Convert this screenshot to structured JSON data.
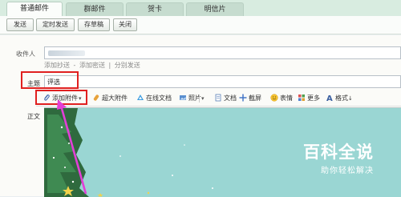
{
  "tabs": [
    {
      "label": "普通邮件",
      "active": true
    },
    {
      "label": "群邮件",
      "active": false
    },
    {
      "label": "贺卡",
      "active": false
    },
    {
      "label": "明信片",
      "active": false
    }
  ],
  "actions": {
    "send": "发送",
    "scheduled_send": "定时发送",
    "save_draft": "存草稿",
    "close": "关闭"
  },
  "form": {
    "recipient_label": "收件人",
    "add_cc": "添加抄送",
    "dash": "-",
    "add_bcc": "添加密送",
    "pipe": "|",
    "separate_send": "分别发送",
    "subject_label": "主题",
    "subject_value": "评选",
    "body_label": "正文"
  },
  "toolbar": {
    "add_attachment": "添加附件",
    "large_attachment": "超大附件",
    "online_doc": "在线文档",
    "photo": "照片",
    "document": "文档",
    "screenshot": "截屏",
    "emoji": "表情",
    "more": "更多",
    "format": "格式"
  },
  "watermark": {
    "title": "百科全说",
    "subtitle": "助你轻松解决"
  },
  "colors": {
    "highlight": "#e02020",
    "arrow": "#e23fd6",
    "editor_background": "#9ad6d3",
    "tab_bar": "#d8ece0"
  }
}
